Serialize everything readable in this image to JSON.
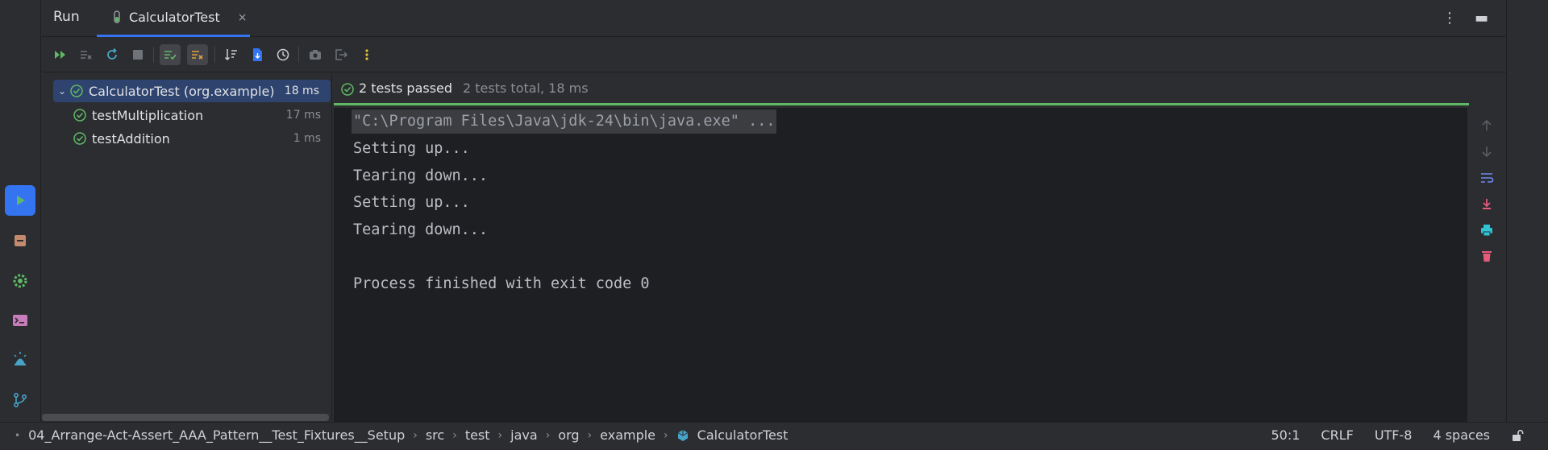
{
  "tabbar": {
    "run_title": "Run",
    "tab_label": "CalculatorTest",
    "close_glyph": "×"
  },
  "tree": {
    "root": {
      "label": "CalculatorTest (org.example)",
      "duration": "18 ms"
    },
    "children": [
      {
        "label": "testMultiplication",
        "duration": "17 ms"
      },
      {
        "label": "testAddition",
        "duration": "1 ms"
      }
    ]
  },
  "console": {
    "status_main": "2 tests passed",
    "status_sub": "2 tests total, 18 ms",
    "lines": [
      "\"C:\\Program Files\\Java\\jdk-24\\bin\\java.exe\" ...",
      "Setting up...",
      "Tearing down...",
      "Setting up...",
      "Tearing down...",
      "",
      "Process finished with exit code 0"
    ]
  },
  "statusbar": {
    "breadcrumbs": [
      "04_Arrange-Act-Assert_AAA_Pattern__Test_Fixtures__Setup",
      "src",
      "test",
      "java",
      "org",
      "example",
      "CalculatorTest"
    ],
    "position": "50:1",
    "line_ending": "CRLF",
    "encoding": "UTF-8",
    "indent": "4 spaces"
  },
  "colors": {
    "accent": "#3574f0",
    "pass_green": "#5fb865",
    "console_bg": "#1e1f22",
    "panel_bg": "#2b2d30"
  }
}
